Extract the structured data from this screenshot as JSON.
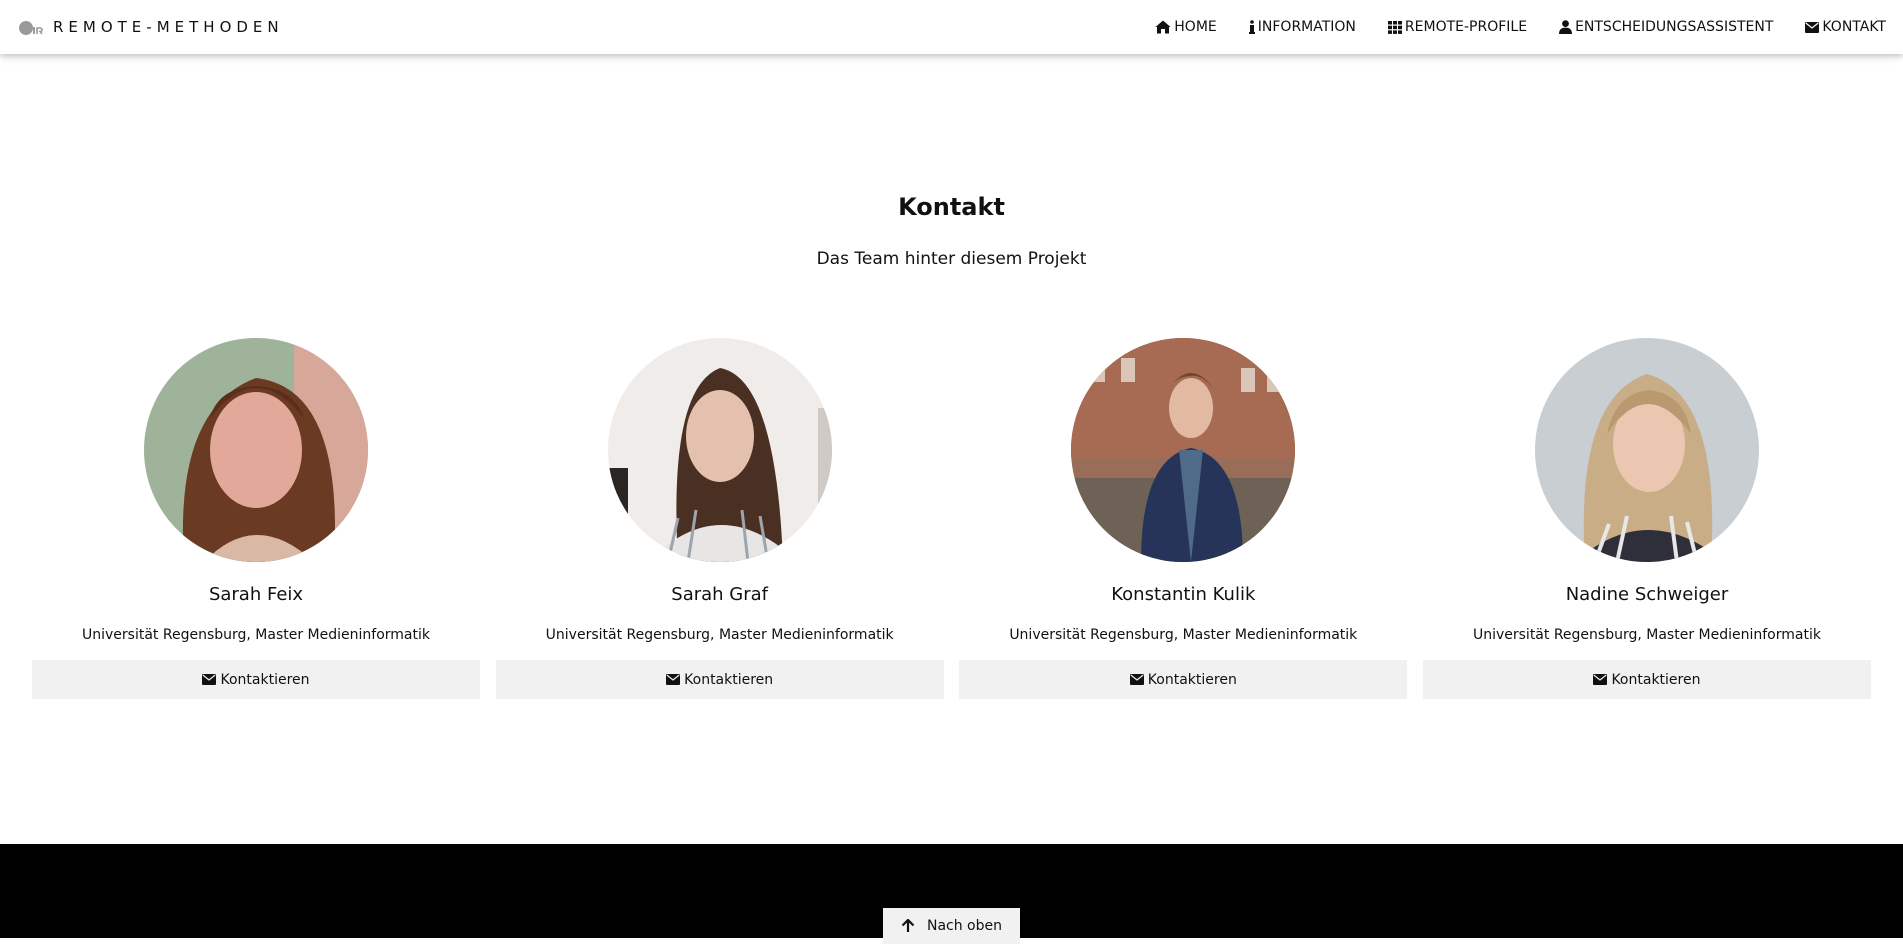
{
  "navbar": {
    "brand": "REMOTE-METHODEN",
    "brand_logo_icon": "ur-logo-icon",
    "items": [
      {
        "label": "HOME",
        "icon": "home-icon"
      },
      {
        "label": "INFORMATION",
        "icon": "info-icon"
      },
      {
        "label": "REMOTE-PROFILE",
        "icon": "grid-icon"
      },
      {
        "label": "ENTSCHEIDUNGSASSISTENT",
        "icon": "user-icon"
      },
      {
        "label": "KONTAKT",
        "icon": "envelope-icon"
      }
    ]
  },
  "section": {
    "title": "Kontakt",
    "subtitle": "Das Team hinter diesem Projekt"
  },
  "team": [
    {
      "name": "Sarah Feix",
      "role": "Universität Regensburg, Master Medieninformatik",
      "button": "Kontaktieren"
    },
    {
      "name": "Sarah Graf",
      "role": "Universität Regensburg, Master Medieninformatik",
      "button": "Kontaktieren"
    },
    {
      "name": "Konstantin Kulik",
      "role": "Universität Regensburg, Master Medieninformatik",
      "button": "Kontaktieren"
    },
    {
      "name": "Nadine Schweiger",
      "role": "Universität Regensburg, Master Medieninformatik",
      "button": "Kontaktieren"
    }
  ],
  "footer": {
    "to_top_label": "Nach oben",
    "to_top_icon": "arrow-up-icon",
    "background": "#000000"
  },
  "colors": {
    "button_bg": "#f1f1f1",
    "text": "#111111"
  }
}
